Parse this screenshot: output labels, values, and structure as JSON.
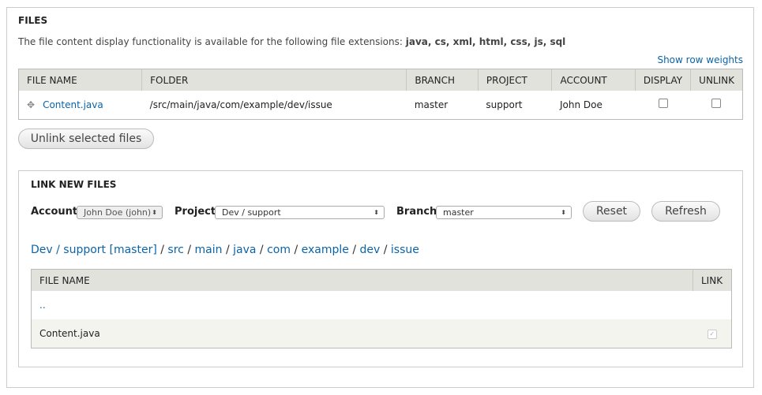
{
  "files": {
    "title": "FILES",
    "description": "The file content display functionality is available for the following file extensions: ",
    "extensions": "java, cs, xml, html, css, js, sql",
    "show_row_weights": "Show row weights",
    "columns": [
      "FILE NAME",
      "FOLDER",
      "BRANCH",
      "PROJECT",
      "ACCOUNT",
      "DISPLAY",
      "UNLINK"
    ],
    "rows": [
      {
        "file": "Content.java",
        "folder": "/src/main/java/com/example/dev/issue",
        "branch": "master",
        "project": "support",
        "account": "John Doe",
        "display": false,
        "unlink": false
      }
    ],
    "unlink_button": "Unlink selected files"
  },
  "link_new": {
    "title": "LINK NEW FILES",
    "account_label": "Account",
    "account_value": "John Doe (john)",
    "project_label": "Project",
    "project_value": "Dev / support",
    "branch_label": "Branch",
    "branch_value": "master",
    "reset": "Reset",
    "refresh": "Refresh",
    "breadcrumb": {
      "root": "Dev / support [master]",
      "sep": "/",
      "parts": [
        "src",
        "main",
        "java",
        "com",
        "example",
        "dev",
        "issue"
      ]
    },
    "columns": [
      "FILE NAME",
      "LINK"
    ],
    "rows": [
      {
        "name": ".."
      },
      {
        "name": "Content.java",
        "checked": true
      }
    ]
  }
}
